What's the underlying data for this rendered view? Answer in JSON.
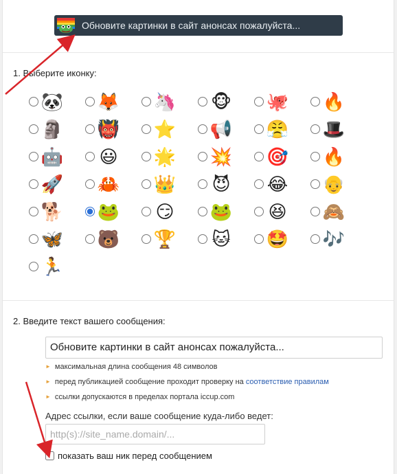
{
  "preview": {
    "icon": "rainbow-frog-icon",
    "text": "Обновите картинки в сайт анонсах пожалуйста..."
  },
  "step1": {
    "title": "1. Выберите иконку:"
  },
  "icons": [
    {
      "name": "panda-icon",
      "glyph": "🐼",
      "selected": false
    },
    {
      "name": "fox-icon",
      "glyph": "🦊",
      "selected": false
    },
    {
      "name": "unicorn-icon",
      "glyph": "🦄",
      "selected": false
    },
    {
      "name": "see-no-evil-monkey-icon",
      "glyph": "🐵",
      "selected": false
    },
    {
      "name": "octopus-icon",
      "glyph": "🐙",
      "selected": false
    },
    {
      "name": "fire-icon",
      "glyph": "🔥",
      "selected": false
    },
    {
      "name": "blue-statue-icon",
      "glyph": "🗿",
      "selected": false
    },
    {
      "name": "green-orc-icon",
      "glyph": "👹",
      "selected": false
    },
    {
      "name": "star-icon",
      "glyph": "⭐",
      "selected": false
    },
    {
      "name": "megaphone-icon",
      "glyph": "📢",
      "selected": false
    },
    {
      "name": "angry-face-icon",
      "glyph": "😤",
      "selected": false
    },
    {
      "name": "wizard-hat-icon",
      "glyph": "🎩",
      "selected": false
    },
    {
      "name": "robot-icon",
      "glyph": "🤖",
      "selected": false
    },
    {
      "name": "smiley-face-icon",
      "glyph": "😃",
      "selected": false
    },
    {
      "name": "star-face-icon",
      "glyph": "🌟",
      "selected": false
    },
    {
      "name": "omg-icon",
      "glyph": "💥",
      "selected": false
    },
    {
      "name": "target-icon",
      "glyph": "🎯",
      "selected": false
    },
    {
      "name": "flame-icon",
      "glyph": "🔥",
      "selected": false
    },
    {
      "name": "rocket-icon",
      "glyph": "🚀",
      "selected": false
    },
    {
      "name": "crab-icon",
      "glyph": "🦀",
      "selected": false
    },
    {
      "name": "crown-icon",
      "glyph": "👑",
      "selected": false
    },
    {
      "name": "devil-face-icon",
      "glyph": "😈",
      "selected": false
    },
    {
      "name": "crying-laughing-icon",
      "glyph": "😂",
      "selected": false
    },
    {
      "name": "harold-meme-icon",
      "glyph": "👴",
      "selected": false
    },
    {
      "name": "doge-icon",
      "glyph": "🐕",
      "selected": false
    },
    {
      "name": "rainbow-frog-icon",
      "glyph": "🐸",
      "selected": true
    },
    {
      "name": "trollface-icon",
      "glyph": "😏",
      "selected": false
    },
    {
      "name": "pepe-frog-icon",
      "glyph": "🐸",
      "selected": false
    },
    {
      "name": "grinning-face-icon",
      "glyph": "😆",
      "selected": false
    },
    {
      "name": "monkey-covering-eyes-icon",
      "glyph": "🙈",
      "selected": false
    },
    {
      "name": "butterfly-icon",
      "glyph": "🦋",
      "selected": false
    },
    {
      "name": "bear-icon",
      "glyph": "🐻",
      "selected": false
    },
    {
      "name": "trophy-icon",
      "glyph": "🏆",
      "selected": false
    },
    {
      "name": "cat-icon",
      "glyph": "🐱",
      "selected": false
    },
    {
      "name": "star-struck-icon",
      "glyph": "🤩",
      "selected": false
    },
    {
      "name": "music-notes-icon",
      "glyph": "🎶",
      "selected": false
    },
    {
      "name": "running-man-icon",
      "glyph": "🏃",
      "selected": false
    }
  ],
  "step2": {
    "title": "2. Введите текст вашего сообщения:"
  },
  "message": {
    "value": "Обновите картинки в сайт анонсах пожалуйста..."
  },
  "hints": [
    {
      "text": "максимальная длина сообщения 48 символов",
      "link": ""
    },
    {
      "text": "перед публикацией сообщение проходит проверку на ",
      "link": "соответствие правилам"
    },
    {
      "text": "ссылки допускаются в пределах портала iccup.com",
      "link": ""
    }
  ],
  "url": {
    "label": "Адрес ссылки, если ваше сообщение куда-либо ведет:",
    "placeholder": "http(s)://site_name.domain/..."
  },
  "nick": {
    "label": "показать ваш ник перед сообщением",
    "checked": false
  },
  "colors": {
    "preview_bg": "#2f3c48",
    "link": "#2a5db0",
    "bullet": "#e6a23c",
    "arrow": "#d9252a",
    "radio_selected": "#2b6fd6"
  }
}
